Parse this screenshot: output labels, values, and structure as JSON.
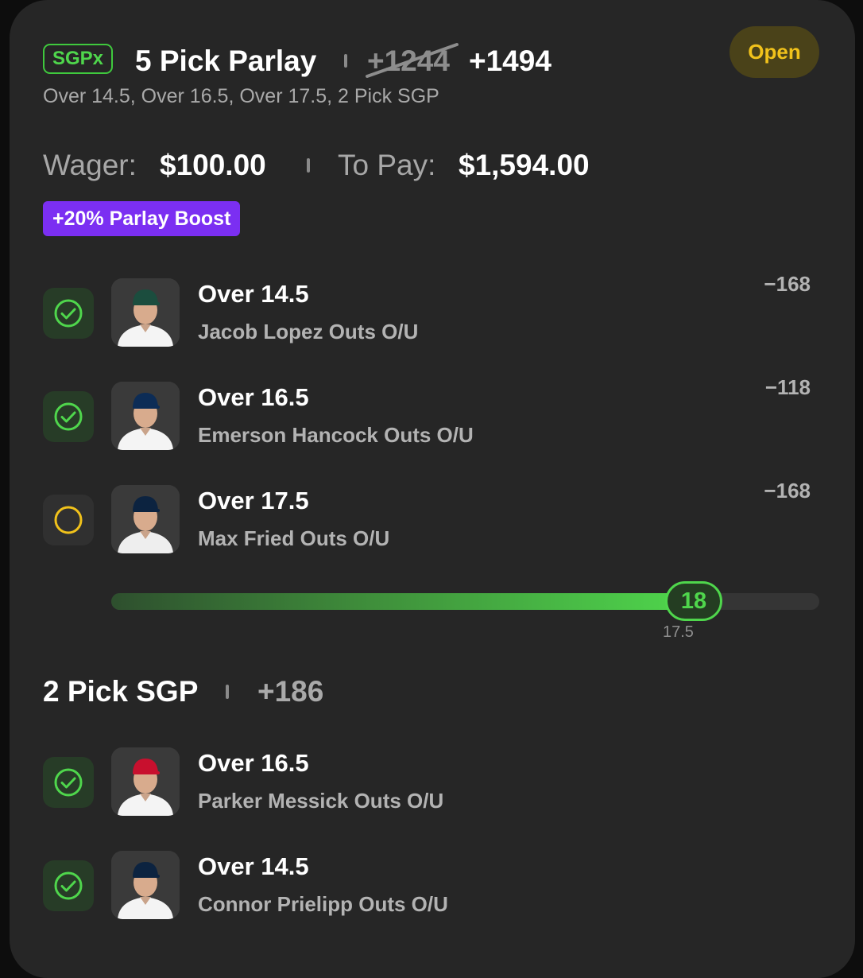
{
  "bet": {
    "badge": "SGPx",
    "title": "5 Pick Parlay",
    "original_odds": "+1244",
    "boosted_odds": "+1494",
    "status": "Open",
    "subtitle": "Over 14.5, Over 16.5, Over 17.5, 2 Pick SGP",
    "wager_label": "Wager:",
    "wager_value": "$100.00",
    "to_pay_label": "To Pay:",
    "to_pay_value": "$1,594.00",
    "boost_label": "+20% Parlay Boost"
  },
  "picks": [
    {
      "line": "Over 14.5",
      "market": "Jacob Lopez Outs O/U",
      "odds": "−168",
      "status": "won",
      "cap_color": "#1b4d3e",
      "jersey_color": "#f4f4f4"
    },
    {
      "line": "Over 16.5",
      "market": "Emerson Hancock Outs O/U",
      "odds": "−118",
      "status": "won",
      "cap_color": "#0c2c56",
      "jersey_color": "#f4f4f4"
    },
    {
      "line": "Over 17.5",
      "market": "Max Fried Outs O/U",
      "odds": "−168",
      "status": "pending",
      "cap_color": "#0c2340",
      "jersey_color": "#eeeeee"
    }
  ],
  "progress": {
    "current": "18",
    "threshold": "17.5",
    "fill_fraction": 0.82
  },
  "sgp": {
    "title": "2 Pick SGP",
    "odds": "+186",
    "picks": [
      {
        "line": "Over 16.5",
        "market": "Parker Messick Outs O/U",
        "status": "won",
        "cap_color": "#c8102e",
        "jersey_color": "#f4f4f4"
      },
      {
        "line": "Over 14.5",
        "market": "Connor Prielipp Outs O/U",
        "status": "won",
        "cap_color": "#0c2340",
        "jersey_color": "#f4f4f4"
      }
    ]
  },
  "colors": {
    "accent_green": "#4fd64c",
    "pending_yellow": "#f1c21b",
    "boost_purple": "#7b2ff2"
  }
}
